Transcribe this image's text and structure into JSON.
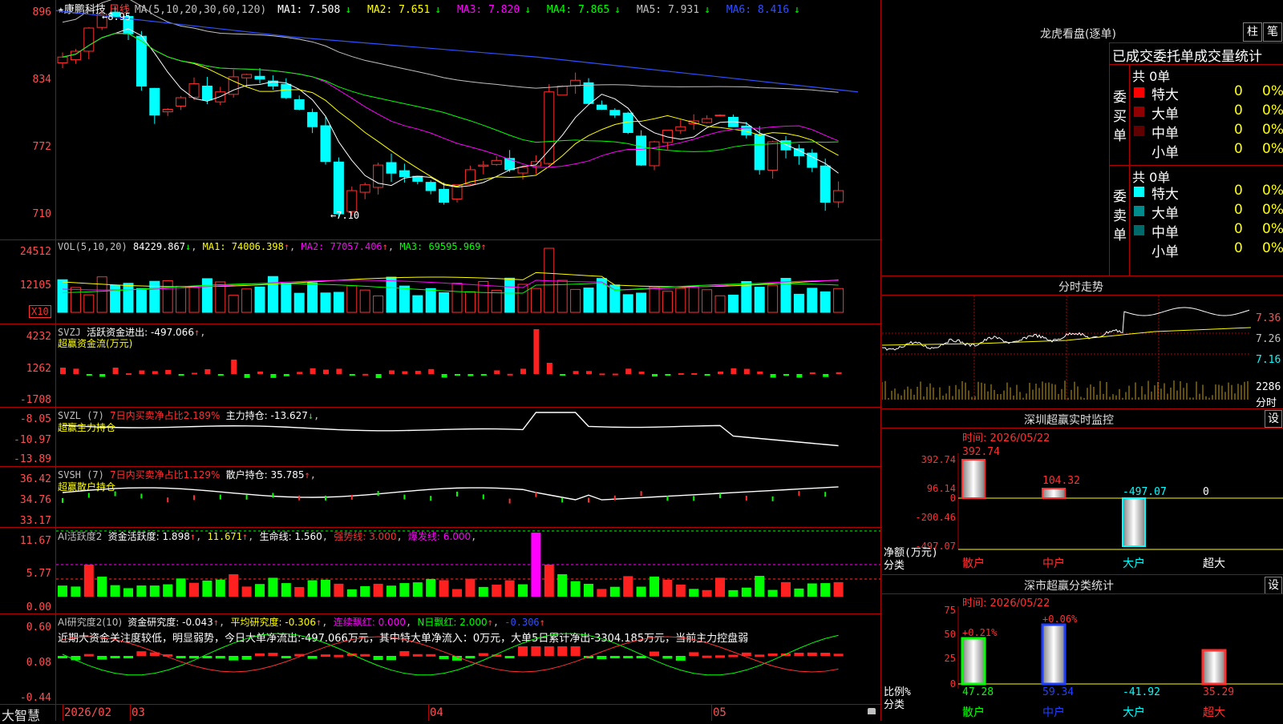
{
  "stock": {
    "star": "★",
    "name": "康鹏科技",
    "period": "日线"
  },
  "ma_header": {
    "label": "MA(5,10,20,30,60,120)",
    "items": [
      {
        "text": "MA1: 7.508",
        "arrow": "↓",
        "color": "#ffffff"
      },
      {
        "text": "MA2: 7.651",
        "arrow": "↓",
        "color": "#ffff00"
      },
      {
        "text": "MA3: 7.820",
        "arrow": "↓",
        "color": "#ff00ff"
      },
      {
        "text": "MA4: 7.865",
        "arrow": "↓",
        "color": "#00ff00"
      },
      {
        "text": "MA5: 7.931",
        "arrow": "↓",
        "color": "#c0c0c0"
      },
      {
        "text": "MA6: 8.416",
        "arrow": "↓",
        "color": "#3050ff"
      }
    ]
  },
  "price_axis": [
    "896",
    "834",
    "772",
    "710"
  ],
  "price_annotations": {
    "high": "8.95",
    "low": "7.10"
  },
  "vol_header": {
    "label": "VOL(5,10,20)",
    "value": "84229.867",
    "ma1": "MA1: 74006.398",
    "ma2": "MA2: 77057.406",
    "ma3": "MA3: 69595.969"
  },
  "vol_axis": [
    "24512",
    "12105"
  ],
  "vol_unit": "X10",
  "svzj": {
    "label": "SVZJ",
    "text": "活跃资金进出: -497.066",
    "sub": "超赢资金流(万元)",
    "axis": [
      "4232",
      "1262",
      "-1708"
    ]
  },
  "svzl": {
    "label": "SVZL (7)",
    "text": "7日内买卖净占比2.189%",
    "text2": "主力持仓: -13.627",
    "sub": "超赢主力持仓",
    "axis": [
      "-8.05",
      "-10.97",
      "-13.89"
    ]
  },
  "svsh": {
    "label": "SVSH (7)",
    "text": "7日内买卖净占比1.129%",
    "text2": "散户持仓: 35.785",
    "sub": "超赢散户持仓",
    "axis": [
      "36.42",
      "34.76",
      "33.17"
    ]
  },
  "ai_active": {
    "label": "AI活跃度2",
    "t1": "资金活跃度: 1.898",
    "t2": "11.671",
    "t3": "生命线: 1.560",
    "t4": "强势线: 3.000",
    "t5": "爆发线: 6.000",
    "axis": [
      "11.67",
      "5.77",
      "0.00"
    ]
  },
  "ai_research": {
    "label": "AI研究度2(10)",
    "t1": "资金研究度: -0.043",
    "t2": "平均研究度: -0.306",
    "t3": "连续飘红: 0.000",
    "t4": "N日飘红: 2.000",
    "t5": "-0.306",
    "comment": "近期大资金关注度较低，明显弱势，今日大单净流出:-497.066万元，其中特大单净流入：0万元，大单5日累计净出-3304.185万元，当前主力控盘弱",
    "axis": [
      "0.60",
      "0.08",
      "-0.44"
    ]
  },
  "date_axis": {
    "brand": "大智慧",
    "labels": [
      "2026/02",
      "03",
      "04",
      "05"
    ]
  },
  "longhu": {
    "title": "龙虎看盘(逐单)",
    "btn1": "柱",
    "btn2": "笔",
    "header": "已成交委托单成交量统计",
    "buy": {
      "side": "委买单",
      "total": "共 0单",
      "rows": [
        {
          "name": "特大",
          "val": "0",
          "pct": "0%",
          "color": "#ff0000"
        },
        {
          "name": "大单",
          "val": "0",
          "pct": "0%",
          "color": "#900000"
        },
        {
          "name": "中单",
          "val": "0",
          "pct": "0%",
          "color": "#600000"
        },
        {
          "name": "小单",
          "val": "0",
          "pct": "0%",
          "color": "#000000"
        }
      ]
    },
    "sell": {
      "side": "委卖单",
      "total": "共 0单",
      "rows": [
        {
          "name": "特大",
          "val": "0",
          "pct": "0%",
          "color": "#00ffff"
        },
        {
          "name": "大单",
          "val": "0",
          "pct": "0%",
          "color": "#008c8c"
        },
        {
          "name": "中单",
          "val": "0",
          "pct": "0%",
          "color": "#006a6a"
        },
        {
          "name": "小单",
          "val": "0",
          "pct": "0%",
          "color": "#000000"
        }
      ]
    }
  },
  "intraday": {
    "title": "分时走势",
    "axis": [
      "7.36",
      "7.26",
      "7.16"
    ],
    "vol_axis": [
      "2286",
      "分时"
    ]
  },
  "sz_monitor": {
    "title": "深圳超赢实时监控",
    "btn": "设",
    "time": "时间: 2026/05/22",
    "axis": [
      "392.74",
      "96.14",
      "0",
      "-200.46",
      "-497.07"
    ],
    "y_label": "净额(万元)",
    "x_label": "分类",
    "categories": [
      "散户",
      "中户",
      "大户",
      "超大"
    ],
    "values": [
      "392.74",
      "104.32",
      "-497.07",
      "0"
    ]
  },
  "sz_class": {
    "title": "深市超赢分类统计",
    "btn": "设",
    "time": "时间: 2026/05/22",
    "axis": [
      "75",
      "50",
      "25",
      "0"
    ],
    "y_label": "比例%",
    "x_label": "分类",
    "categories": [
      "散户",
      "中户",
      "大户",
      "超大"
    ],
    "pct_labels": [
      "+0.21%",
      "+0.06%",
      "",
      ""
    ],
    "values": [
      "47.28",
      "59.34",
      "-41.92",
      "35.29"
    ]
  },
  "chart_data": {
    "type": "candlestick",
    "title": "康鹏科技 日线",
    "ylim": [
      7.0,
      9.0
    ],
    "high": 8.95,
    "low": 7.1,
    "x_labels": [
      "2026/02",
      "03",
      "04",
      "05"
    ]
  }
}
